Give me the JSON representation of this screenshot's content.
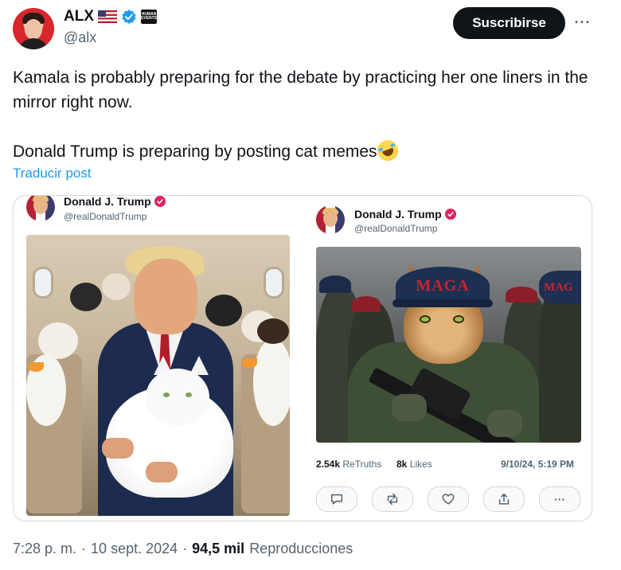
{
  "author": {
    "display_name": "ALX",
    "handle": "@alx",
    "avatar_icon": "avatar",
    "badges": [
      "us-flag-icon",
      "verified-icon",
      "affiliate-badge-icon"
    ],
    "affiliate_badge_text": "HUMAN EVENTS"
  },
  "header": {
    "subscribe_label": "Suscribirse",
    "more_label": "···"
  },
  "tweet": {
    "lines": [
      "Kamala is probably preparing for the debate by practicing her one liners in the mirror right now.",
      "Donald Trump is preparing by posting cat memes"
    ],
    "emoji": "rolling-on-floor-laughing-emoji",
    "translate_label": "Traducir post"
  },
  "embedded": {
    "left_post": {
      "name": "Donald J. Trump",
      "handle": "@realDonaldTrump"
    },
    "right_post": {
      "name": "Donald J. Trump",
      "handle": "@realDonaldTrump",
      "cap_text": "MAGA",
      "side_cap_text": "MAG",
      "retruths_count": "2.54k",
      "retruths_label": "ReTruths",
      "likes_count": "8k",
      "likes_label": "Likes",
      "timestamp": "9/10/24, 5:19 PM",
      "actions": [
        "reply-icon",
        "retruth-icon",
        "like-icon",
        "share-icon",
        "more-icon"
      ],
      "more_label": "···"
    }
  },
  "footer": {
    "time": "7:28 p. m.",
    "separator": "·",
    "date": "10 sept. 2024",
    "views_count": "94,5 mil",
    "views_label": "Reproducciones"
  },
  "colors": {
    "link": "#1d9bf0",
    "verified": "#1d9bf0",
    "truth_badge": "#e0245e",
    "muted": "#536471",
    "button_dark": "#0f1419"
  }
}
